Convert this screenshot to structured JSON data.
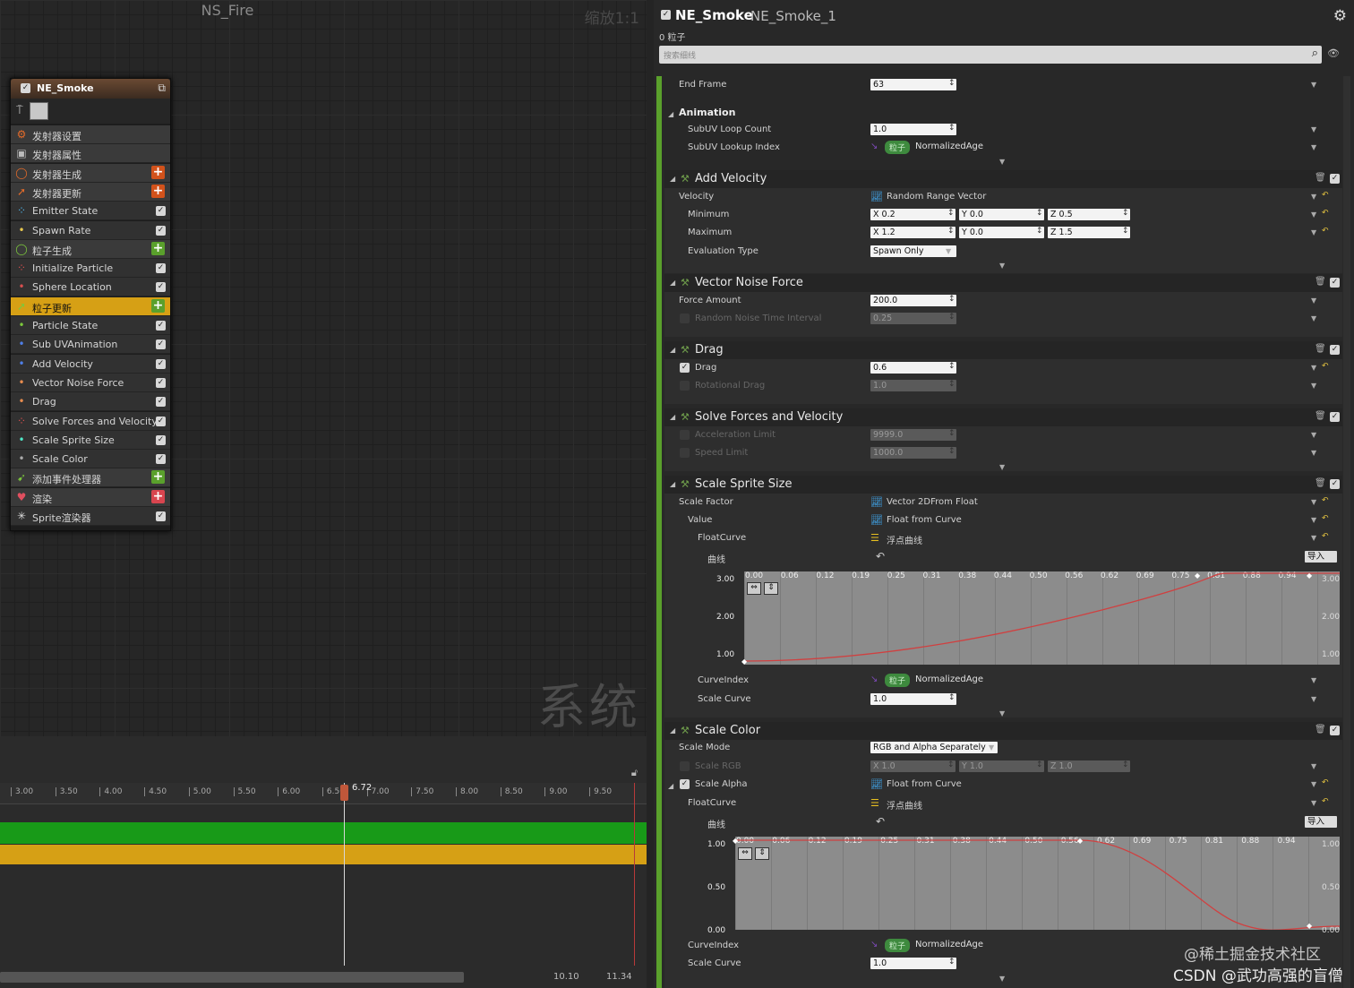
{
  "graph": {
    "title": "NS_Fire",
    "zoom": "缩放1:1",
    "watermark": "系统"
  },
  "node": {
    "title": "NE_Smoke",
    "items": [
      {
        "label": "发射器设置",
        "icon": "settings-icon",
        "color": "#e46b2a",
        "plus": false,
        "check": false
      },
      {
        "label": "发射器属性",
        "icon": "cpu-icon",
        "color": "#bbbbbb",
        "plus": false,
        "check": false
      },
      {
        "label": "发射器生成",
        "icon": "circle-icon",
        "color": "#e46b2a",
        "plus": true,
        "plusColor": "#d2521b",
        "check": false
      },
      {
        "label": "发射器更新",
        "icon": "arrow-icon",
        "color": "#e46b2a",
        "plus": true,
        "plusColor": "#d2521b",
        "check": false
      },
      {
        "label": "Emitter State",
        "icon": "dots-icon",
        "color": "#4fb4e8",
        "plus": false,
        "check": true
      },
      {
        "label": "Spawn Rate",
        "icon": "dot-icon",
        "color": "#e8c84f",
        "plus": false,
        "check": true
      },
      {
        "label": "粒子生成",
        "icon": "circle-icon",
        "color": "#7cc83c",
        "plus": true,
        "plusColor": "#5aa02c",
        "check": false
      },
      {
        "label": "Initialize Particle",
        "icon": "dots-icon",
        "color": "#d84f4f",
        "plus": false,
        "check": true
      },
      {
        "label": "Sphere Location",
        "icon": "dot-icon",
        "color": "#d84f4f",
        "plus": false,
        "check": true
      },
      {
        "label": "粒子更新",
        "icon": "arrow-icon",
        "color": "#7cc83c",
        "plus": true,
        "plusColor": "#5aa02c",
        "check": false,
        "highlight": true
      },
      {
        "label": "Particle State",
        "icon": "dot-icon",
        "color": "#7cc83c",
        "plus": false,
        "check": true
      },
      {
        "label": "Sub UVAnimation",
        "icon": "dot-icon",
        "color": "#4f7fe8",
        "plus": false,
        "check": true
      },
      {
        "label": "Add Velocity",
        "icon": "dot-icon",
        "color": "#4f7fe8",
        "plus": false,
        "check": true
      },
      {
        "label": "Vector Noise Force",
        "icon": "dot-icon",
        "color": "#e88c4f",
        "plus": false,
        "check": true
      },
      {
        "label": "Drag",
        "icon": "dot-icon",
        "color": "#e88c4f",
        "plus": false,
        "check": true
      },
      {
        "label": "Solve Forces and Velocity",
        "icon": "dots-icon",
        "color": "#d84f4f",
        "plus": false,
        "check": true
      },
      {
        "label": "Scale Sprite Size",
        "icon": "dot-icon",
        "color": "#4fe8c8",
        "plus": false,
        "check": true
      },
      {
        "label": "Scale Color",
        "icon": "dot-icon",
        "color": "#aaaaaa",
        "plus": false,
        "check": true
      },
      {
        "label": "添加事件处理器",
        "icon": "event-icon",
        "color": "#7cc83c",
        "plus": true,
        "plusColor": "#5aa02c",
        "check": false
      },
      {
        "label": "渲染",
        "icon": "heart-icon",
        "color": "#e04f5f",
        "plus": true,
        "plusColor": "#d8454f",
        "check": false
      },
      {
        "label": "Sprite渲染器",
        "icon": "sprite-icon",
        "color": "#dddddd",
        "plus": false,
        "check": true
      }
    ]
  },
  "timeline": {
    "current": "6.72",
    "ticks": [
      "3.00",
      "3.50",
      "4.00",
      "4.50",
      "5.00",
      "5.50",
      "6.00",
      "6.50",
      "7.00",
      "7.50",
      "8.00",
      "8.50",
      "9.00",
      "9.50"
    ],
    "end1": "10.10",
    "end2": "11.34"
  },
  "details": {
    "emitter": "NE_Smoke",
    "instance": "NE_Smoke_1",
    "count": "0 粒子",
    "search_placeholder": "搜索细线",
    "end_frame_label": "End Frame",
    "end_frame": "63",
    "animation": "Animation",
    "subuv_loop_label": "SubUV Loop Count",
    "subuv_loop": "1.0",
    "subuv_lookup_label": "SubUV Lookup Index",
    "particle_tag": "粒子",
    "normalized_age": "NormalizedAge",
    "add_velocity": "Add Velocity",
    "velocity_label": "Velocity",
    "velocity_type": "Random Range Vector",
    "minimum_label": "Minimum",
    "maximum_label": "Maximum",
    "min": [
      "X 0.2",
      "Y 0.0",
      "Z 0.5"
    ],
    "max": [
      "X 1.2",
      "Y 0.0",
      "Z 1.5"
    ],
    "eval_label": "Evaluation Type",
    "eval": "Spawn Only",
    "vnf": "Vector Noise Force",
    "force_label": "Force Amount",
    "force": "200.0",
    "noise_interval_label": "Random Noise Time Interval",
    "noise_interval": "0.25",
    "drag": "Drag",
    "drag_label": "Drag",
    "drag_val": "0.6",
    "rot_drag_label": "Rotational Drag",
    "rot_drag": "1.0",
    "sfv": "Solve Forces and Velocity",
    "accel_label": "Acceleration Limit",
    "accel": "9999.0",
    "speed_label": "Speed Limit",
    "speed": "1000.0",
    "sss": "Scale Sprite Size",
    "scale_factor_label": "Scale Factor",
    "scale_factor_type": "Vector 2DFrom Float",
    "value_label": "Value",
    "float_from_curve": "Float from Curve",
    "floatcurve_label": "FloatCurve",
    "float_curve_cn": "浮点曲线",
    "curve_label": "曲线",
    "import": "导入",
    "curve1_x": [
      "0.00",
      "0.06",
      "0.12",
      "0.19",
      "0.25",
      "0.31",
      "0.38",
      "0.44",
      "0.50",
      "0.56",
      "0.62",
      "0.69",
      "0.75",
      "0.81",
      "0.88",
      "0.94"
    ],
    "curve1_y": [
      "3.00",
      "2.00",
      "1.00"
    ],
    "curveindex_label": "CurveIndex",
    "scale_curve_label": "Scale Curve",
    "scale_curve": "1.0",
    "sc": "Scale Color",
    "scale_mode_label": "Scale Mode",
    "scale_mode": "RGB and Alpha Separately",
    "scale_rgb_label": "Scale RGB",
    "rgb": [
      "X 1.0",
      "Y 1.0",
      "Z 1.0"
    ],
    "scale_alpha_label": "Scale Alpha",
    "curve2_y": [
      "1.00",
      "0.50",
      "0.00"
    ]
  },
  "footer_watermark": [
    "@稀土掘金技术社区",
    "CSDN @武功高强的盲僧"
  ]
}
